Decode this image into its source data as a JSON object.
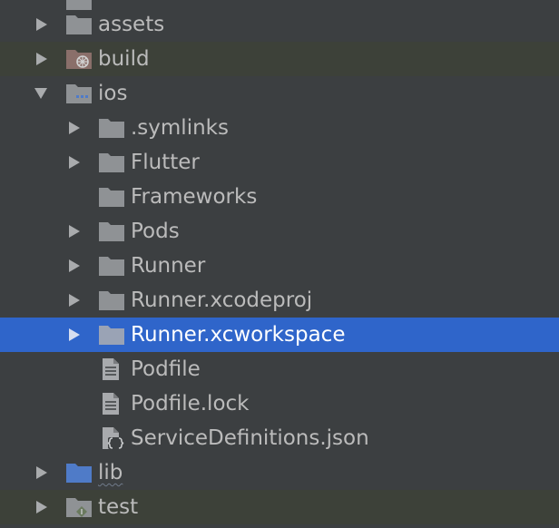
{
  "colors": {
    "panel_bg": "#3c3f41",
    "excluded_bg": "#3d4139",
    "selection_bg": "#2f65ca",
    "text": "#bbbbbb",
    "folder_icon": "#8f9295",
    "blue_folder_icon": "#4f7bc8"
  },
  "tree": {
    "items": [
      {
        "label": "assets"
      },
      {
        "label": "build"
      },
      {
        "label": "ios"
      },
      {
        "label": ".symlinks"
      },
      {
        "label": "Flutter"
      },
      {
        "label": "Frameworks"
      },
      {
        "label": "Pods"
      },
      {
        "label": "Runner"
      },
      {
        "label": "Runner.xcodeproj"
      },
      {
        "label": "Runner.xcworkspace"
      },
      {
        "label": "Podfile"
      },
      {
        "label": "Podfile.lock"
      },
      {
        "label": "ServiceDefinitions.json"
      },
      {
        "label": "lib"
      },
      {
        "label": "test"
      }
    ]
  }
}
